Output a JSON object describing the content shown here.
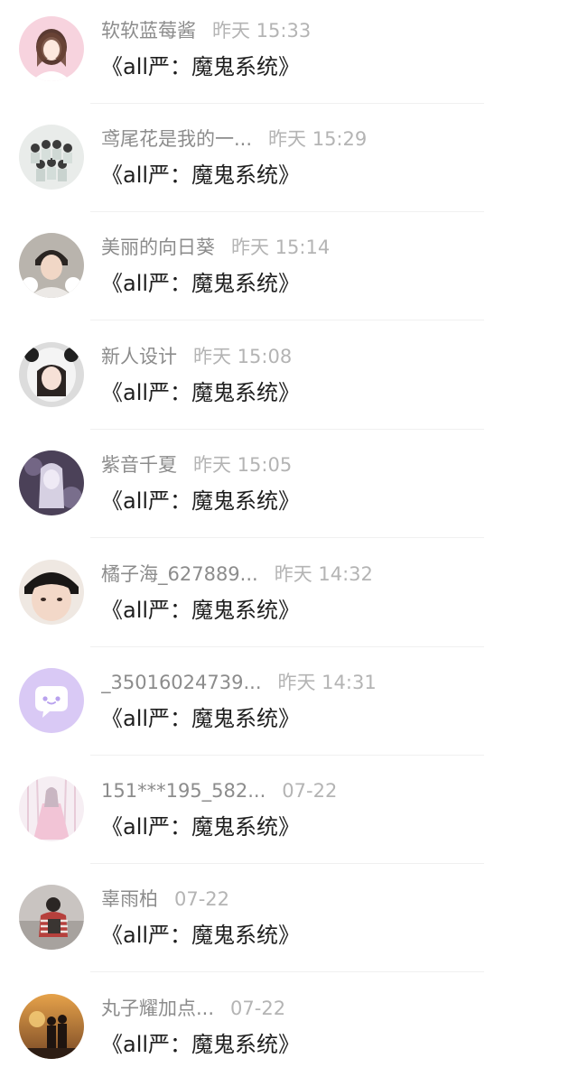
{
  "comments": [
    {
      "name": "软软蓝莓酱",
      "time": "昨天 15:33",
      "message": "《all严：魔鬼系统》",
      "avatar": "avatar-anime-girl-pink"
    },
    {
      "name": "鸢尾花是我的一...",
      "time": "昨天 15:29",
      "message": "《all严：魔鬼系统》",
      "avatar": "avatar-group-photo"
    },
    {
      "name": "美丽的向日葵",
      "time": "昨天 15:14",
      "message": "《all严：魔鬼系统》",
      "avatar": "avatar-boy-portrait"
    },
    {
      "name": "新人设计",
      "time": "昨天 15:08",
      "message": "《all严：魔鬼系统》",
      "avatar": "avatar-girl-panda-hood"
    },
    {
      "name": "紫音千夏",
      "time": "昨天 15:05",
      "message": "《all严：魔鬼系统》",
      "avatar": "avatar-purple-anime"
    },
    {
      "name": "橘子海_627889...",
      "time": "昨天 14:32",
      "message": "《all严：魔鬼系统》",
      "avatar": "avatar-boy-closeup"
    },
    {
      "name": "_35016024739...",
      "time": "昨天 14:31",
      "message": "《all严：魔鬼系统》",
      "avatar": "avatar-default-chat-bubble"
    },
    {
      "name": "151***195_582...",
      "time": "07-22",
      "message": "《all严：魔鬼系统》",
      "avatar": "avatar-anime-girl-dress"
    },
    {
      "name": "辜雨柏",
      "time": "07-22",
      "message": "《all严：魔鬼系统》",
      "avatar": "avatar-person-back"
    },
    {
      "name": "丸子耀加点...",
      "time": "07-22",
      "message": "《all严：魔鬼系统》",
      "avatar": "avatar-couple-sunset"
    }
  ]
}
